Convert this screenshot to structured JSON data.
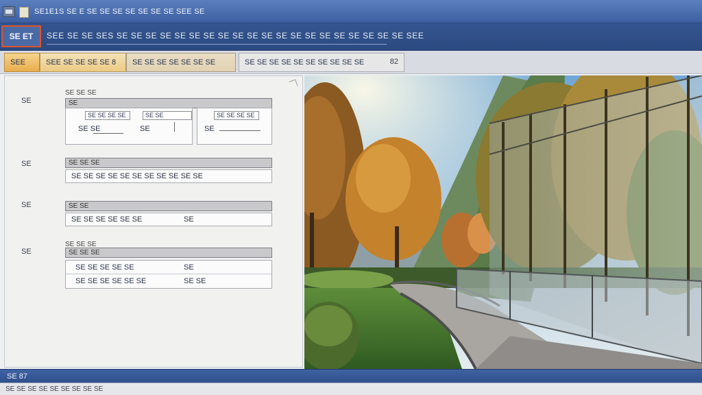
{
  "titlebar": {
    "title_left": "SE1E1",
    "title_right": "S SE E SE SE SE SE SE SE SE SEE SE"
  },
  "header": {
    "button_label": "SE ET",
    "title": "SEE SE SE SES SE SE SE SE SE SE SE SE SE SE SE SE SE SE SE SE SE SE SE SE SEE"
  },
  "tabs": [
    {
      "label": "SEE"
    },
    {
      "label": "SEE SE SE SE SE 8"
    },
    {
      "label": "SE SE SE SE SE SE SE"
    },
    {
      "label": "SE SE SE SE SE SE SE SE SE SE",
      "badge": "82"
    }
  ],
  "form": {
    "section1": {
      "label": "SE",
      "caption": "SE SE SE",
      "header_bar": "SE",
      "cells": [
        {
          "input": "SE SE SE SE",
          "value": "SE SE"
        },
        {
          "input": "SE SE",
          "value": "SE"
        },
        {
          "input": "SE SE SE SE",
          "value": "SE"
        }
      ]
    },
    "section2": {
      "label": "SE",
      "header_bar": "SE SE SE",
      "field_value": "SE SE SE SE SE SE SE SE SE SE SE"
    },
    "section3": {
      "label": "SE",
      "header_bar": "SE SE",
      "field_value": "SE SE SE SE SE SE",
      "field_value_right": "SE"
    },
    "section4": {
      "label": "SE",
      "caption": "SE SE SE",
      "header_bar": "SE SE SE",
      "rows": [
        {
          "left": "SE SE SE SE SE",
          "right": "SE"
        },
        {
          "left": "SE SE SE SE SE SE",
          "right": "SE SE"
        }
      ]
    }
  },
  "statusbar": {
    "text": "SE 87"
  },
  "bottombar": {
    "text": "SE SE SE SE SE SE SE SE SE"
  },
  "colors": {
    "title_blue": "#3d5fa0",
    "header_blue": "#2c4a82",
    "highlight_orange": "#e0532b",
    "tab_gold": "#e8ad4c"
  }
}
